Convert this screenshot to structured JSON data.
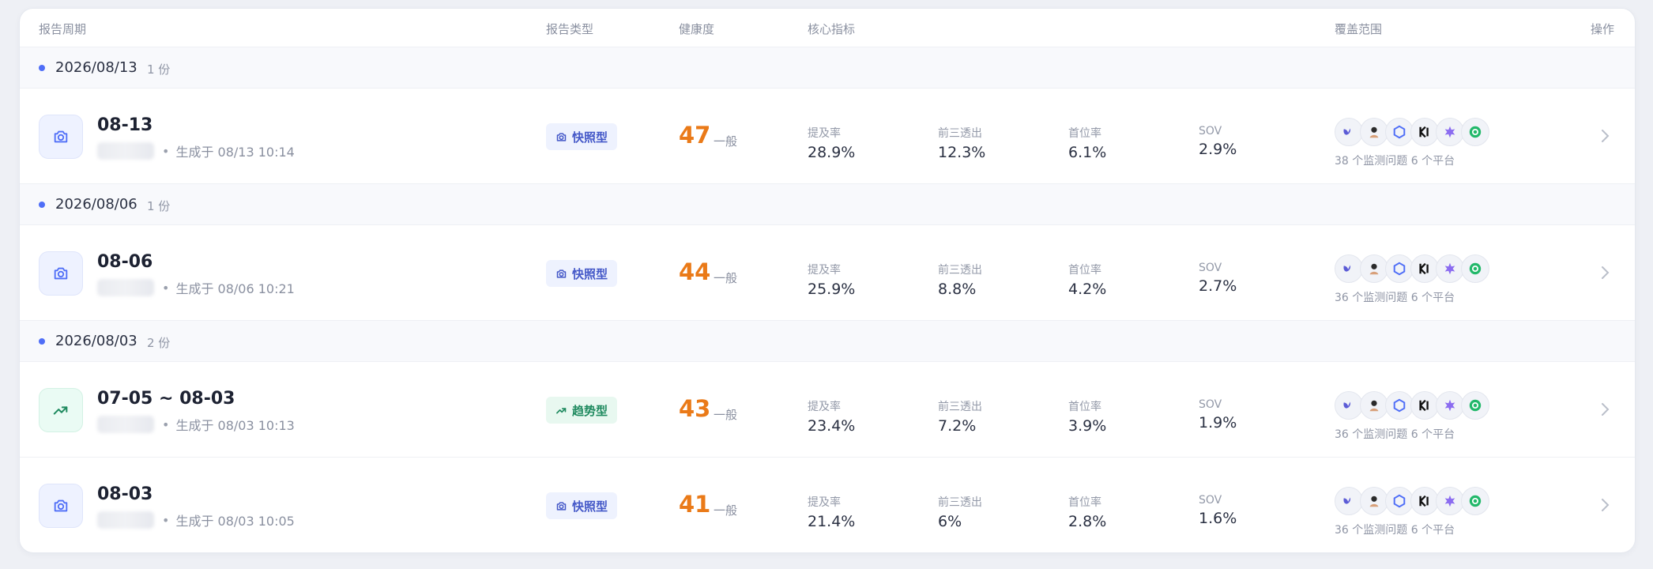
{
  "header": {
    "period": "报告周期",
    "type": "报告类型",
    "health": "健康度",
    "metrics": "核心指标",
    "coverage": "覆盖范围",
    "action": "操作"
  },
  "icons": {
    "snapshot": "camera-icon",
    "trend": "trend-up-icon",
    "chevron": "chevron-right-icon",
    "platforms": [
      "platform-1-icon",
      "platform-2-icon",
      "platform-3-icon",
      "platform-4-icon",
      "platform-5-icon",
      "platform-6-icon"
    ]
  },
  "colors": {
    "accent": "#4f6ef7",
    "score": "#ea7a18",
    "snapshot_badge": "#4458c8",
    "trend_badge": "#1f8a5f"
  },
  "groups": [
    {
      "date": "2026/08/13",
      "count": "1 份",
      "rows": [
        {
          "title": "08-13",
          "generated": "生成于 08/13 10:14",
          "type_label": "快照型",
          "score": "47",
          "score_label": "一般",
          "metrics": [
            {
              "label": "提及率",
              "value": "28.9%"
            },
            {
              "label": "前三透出",
              "value": "12.3%"
            },
            {
              "label": "首位率",
              "value": "6.1%"
            },
            {
              "label": "SOV",
              "value": "2.9%"
            }
          ],
          "coverage": "38 个监测问题 6 个平台"
        }
      ]
    },
    {
      "date": "2026/08/06",
      "count": "1 份",
      "rows": [
        {
          "title": "08-06",
          "generated": "生成于 08/06 10:21",
          "type_label": "快照型",
          "score": "44",
          "score_label": "一般",
          "metrics": [
            {
              "label": "提及率",
              "value": "25.9%"
            },
            {
              "label": "前三透出",
              "value": "8.8%"
            },
            {
              "label": "首位率",
              "value": "4.2%"
            },
            {
              "label": "SOV",
              "value": "2.7%"
            }
          ],
          "coverage": "36 个监测问题 6 个平台"
        }
      ]
    },
    {
      "date": "2026/08/03",
      "count": "2 份",
      "rows": [
        {
          "title": "07-05 ~ 08-03",
          "generated": "生成于 08/03 10:13",
          "type_label": "趋势型",
          "score": "43",
          "score_label": "一般",
          "metrics": [
            {
              "label": "提及率",
              "value": "23.4%"
            },
            {
              "label": "前三透出",
              "value": "7.2%"
            },
            {
              "label": "首位率",
              "value": "3.9%"
            },
            {
              "label": "SOV",
              "value": "1.9%"
            }
          ],
          "coverage": "36 个监测问题 6 个平台"
        },
        {
          "title": "08-03",
          "generated": "生成于 08/03 10:05",
          "type_label": "快照型",
          "score": "41",
          "score_label": "一般",
          "metrics": [
            {
              "label": "提及率",
              "value": "21.4%"
            },
            {
              "label": "前三透出",
              "value": "6%"
            },
            {
              "label": "首位率",
              "value": "2.8%"
            },
            {
              "label": "SOV",
              "value": "1.6%"
            }
          ],
          "coverage": "36 个监测问题 6 个平台"
        }
      ]
    }
  ]
}
